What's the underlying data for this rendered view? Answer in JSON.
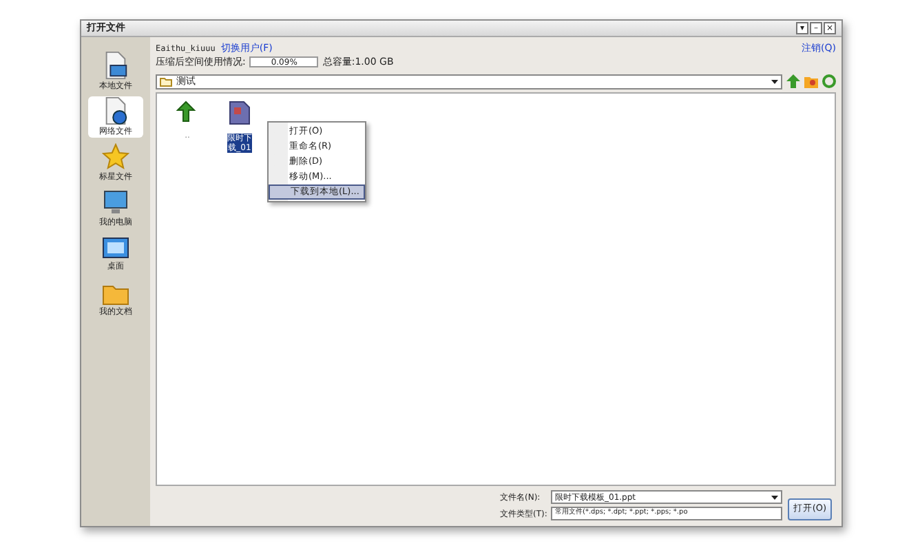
{
  "window": {
    "title": "打开文件",
    "controls": [
      "▾",
      "–",
      "×"
    ]
  },
  "account": {
    "username": "Eaithu_kiuuu",
    "switch_link": "切换用户(F)",
    "logout_link": "注销(Q)",
    "usage_label": "压缩后空间使用情况:",
    "usage_reading": "0.09%",
    "level": 0.0009,
    "total": "总容量:1.00 GB"
  },
  "sidebar": {
    "items": [
      {
        "label": "本地文件",
        "kind": "local",
        "selected": false
      },
      {
        "label": "网络文件",
        "kind": "network",
        "selected": true
      },
      {
        "label": "标星文件",
        "kind": "star",
        "selected": false
      },
      {
        "label": "我的电脑",
        "kind": "computer",
        "selected": false
      },
      {
        "label": "桌面",
        "kind": "desktop",
        "selected": false
      },
      {
        "label": "我的文档",
        "kind": "documents",
        "selected": false
      }
    ]
  },
  "path": {
    "value": "测试"
  },
  "files": [
    {
      "kind": "up",
      "label": "..",
      "selected": false
    },
    {
      "kind": "ppt",
      "lines": [
        "限时下",
        "载_01"
      ],
      "selected": true
    }
  ],
  "context_menu": [
    {
      "label": "打开(O)",
      "selected": false
    },
    {
      "label": "重命名(R)",
      "selected": false
    },
    {
      "label": "删除(D)",
      "selected": false
    },
    {
      "label": "移动(M)...",
      "selected": false
    },
    {
      "label": "下载到本地(L)...",
      "selected": true
    }
  ],
  "filename": {
    "label": "文件名(N):",
    "value": "限时下载模板_01.ppt"
  },
  "filetype": {
    "label": "文件类型(T):",
    "value": "常用文件(*.dps; *.dpt; *.ppt; *.pps; *.po"
  },
  "open_button": "打开(O)"
}
